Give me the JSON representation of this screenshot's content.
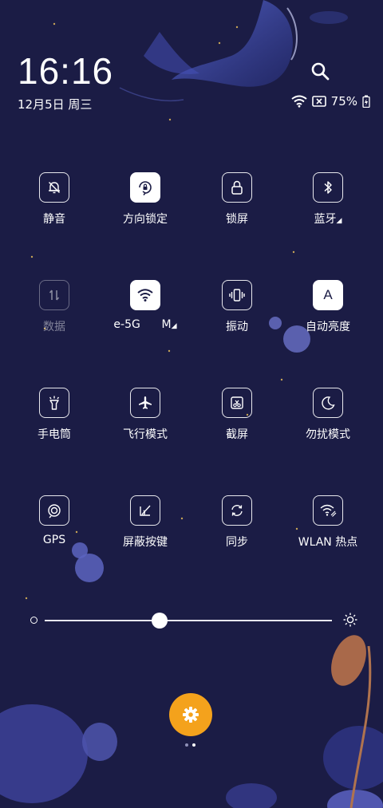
{
  "header": {
    "time": "16:16",
    "date": "12月5日 周三"
  },
  "status": {
    "battery": "75%"
  },
  "tiles": [
    {
      "label": "静音",
      "icon": "bell-off-icon",
      "state": "off"
    },
    {
      "label": "方向锁定",
      "icon": "rotation-lock-icon",
      "state": "on"
    },
    {
      "label": "锁屏",
      "icon": "lock-icon",
      "state": "off"
    },
    {
      "label": "蓝牙",
      "icon": "bluetooth-icon",
      "state": "off"
    },
    {
      "label": "数据",
      "icon": "mobile-data-icon",
      "state": "disabled"
    },
    {
      "label": "e-5G",
      "label_suffix": "M",
      "icon": "wifi-icon",
      "state": "on"
    },
    {
      "label": "振动",
      "icon": "vibrate-icon",
      "state": "off"
    },
    {
      "label": "自动亮度",
      "icon": "auto-brightness-icon",
      "glyph": "A",
      "state": "on"
    },
    {
      "label": "手电筒",
      "icon": "flashlight-icon",
      "state": "off"
    },
    {
      "label": "飞行模式",
      "icon": "airplane-icon",
      "state": "off"
    },
    {
      "label": "截屏",
      "icon": "screenshot-icon",
      "state": "off"
    },
    {
      "label": "勿扰模式",
      "icon": "moon-icon",
      "state": "off"
    },
    {
      "label": "GPS",
      "icon": "gps-icon",
      "state": "off"
    },
    {
      "label": "屏蔽按键",
      "icon": "block-keys-icon",
      "state": "off"
    },
    {
      "label": "同步",
      "icon": "sync-icon",
      "state": "off"
    },
    {
      "label": "WLAN 热点",
      "icon": "hotspot-icon",
      "state": "off"
    }
  ],
  "brightness": {
    "level": 0.4
  },
  "pager": {
    "count": 2,
    "active": 1
  },
  "colors": {
    "background": "#1b1c45",
    "accent": "#f4a21c"
  }
}
